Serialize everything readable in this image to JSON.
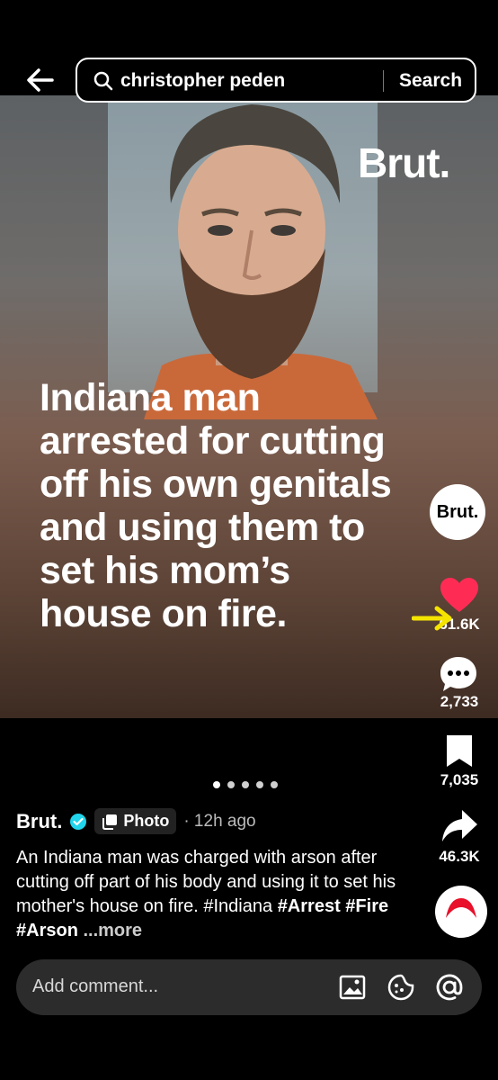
{
  "search": {
    "query": "christopher peden",
    "button_label": "Search"
  },
  "post": {
    "brand_watermark": "Brut.",
    "headline": "Indiana man\narrested for cutting\noff his own genitals\nand using them to\nset his mom’s\nhouse on fire.",
    "slide_count": 5,
    "active_slide": 1
  },
  "rail": {
    "avatar_label": "Brut.",
    "likes": "61.6K",
    "comments": "2,733",
    "saves": "7,035",
    "shares": "46.3K"
  },
  "caption": {
    "author": "Brut.",
    "type_label": "Photo",
    "time": "· 12h ago",
    "text": "An Indiana man was charged with arson after cutting off part of his body and using it to set his mother's house on fire.",
    "tag_plain": "#Indiana",
    "tags_bold": [
      "#Arrest",
      "#Fire",
      "#Arson"
    ],
    "more_label": "...more"
  },
  "comment_bar": {
    "placeholder": "Add comment..."
  },
  "colors": {
    "like_red": "#fe2c55",
    "verified_blue": "#20d5ec",
    "annotation_yellow": "#f5e400"
  },
  "icons": [
    "back-arrow-icon",
    "search-icon",
    "heart-icon",
    "comment-icon",
    "bookmark-icon",
    "share-icon",
    "verified-icon",
    "photo-icon",
    "image-icon",
    "emoji-icon",
    "mention-icon"
  ]
}
